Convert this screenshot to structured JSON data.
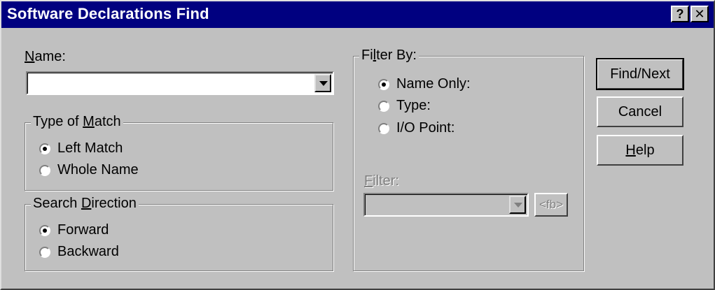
{
  "window": {
    "title": "Software Declarations Find"
  },
  "titlebar": {
    "help_glyph": "?",
    "close_glyph": "✕"
  },
  "name_field": {
    "label_prefix": "",
    "label_accel": "N",
    "label_rest": "ame:",
    "value": ""
  },
  "type_of_match": {
    "title_prefix": "Type of ",
    "title_accel": "M",
    "title_rest": "atch",
    "options": [
      "Left Match",
      "Whole Name"
    ],
    "selected": "Left Match"
  },
  "search_direction": {
    "title_prefix": "Search ",
    "title_accel": "D",
    "title_rest": "irection",
    "options": [
      "Forward",
      "Backward"
    ],
    "selected": "Forward"
  },
  "filter_by": {
    "title_prefix": "Fi",
    "title_accel": "l",
    "title_rest": "ter By:",
    "options": [
      "Name Only:",
      "Type:",
      "I/O Point:"
    ],
    "selected": "Name Only:",
    "filter_label_accel": "F",
    "filter_label_rest": "ilter:",
    "filter_value": "",
    "fb_button": "<fb>"
  },
  "buttons": {
    "find_next": "Find/Next",
    "cancel": "Cancel",
    "help_accel": "H",
    "help_rest": "elp"
  },
  "icons": {
    "dropdown": "chevron-down-icon"
  }
}
